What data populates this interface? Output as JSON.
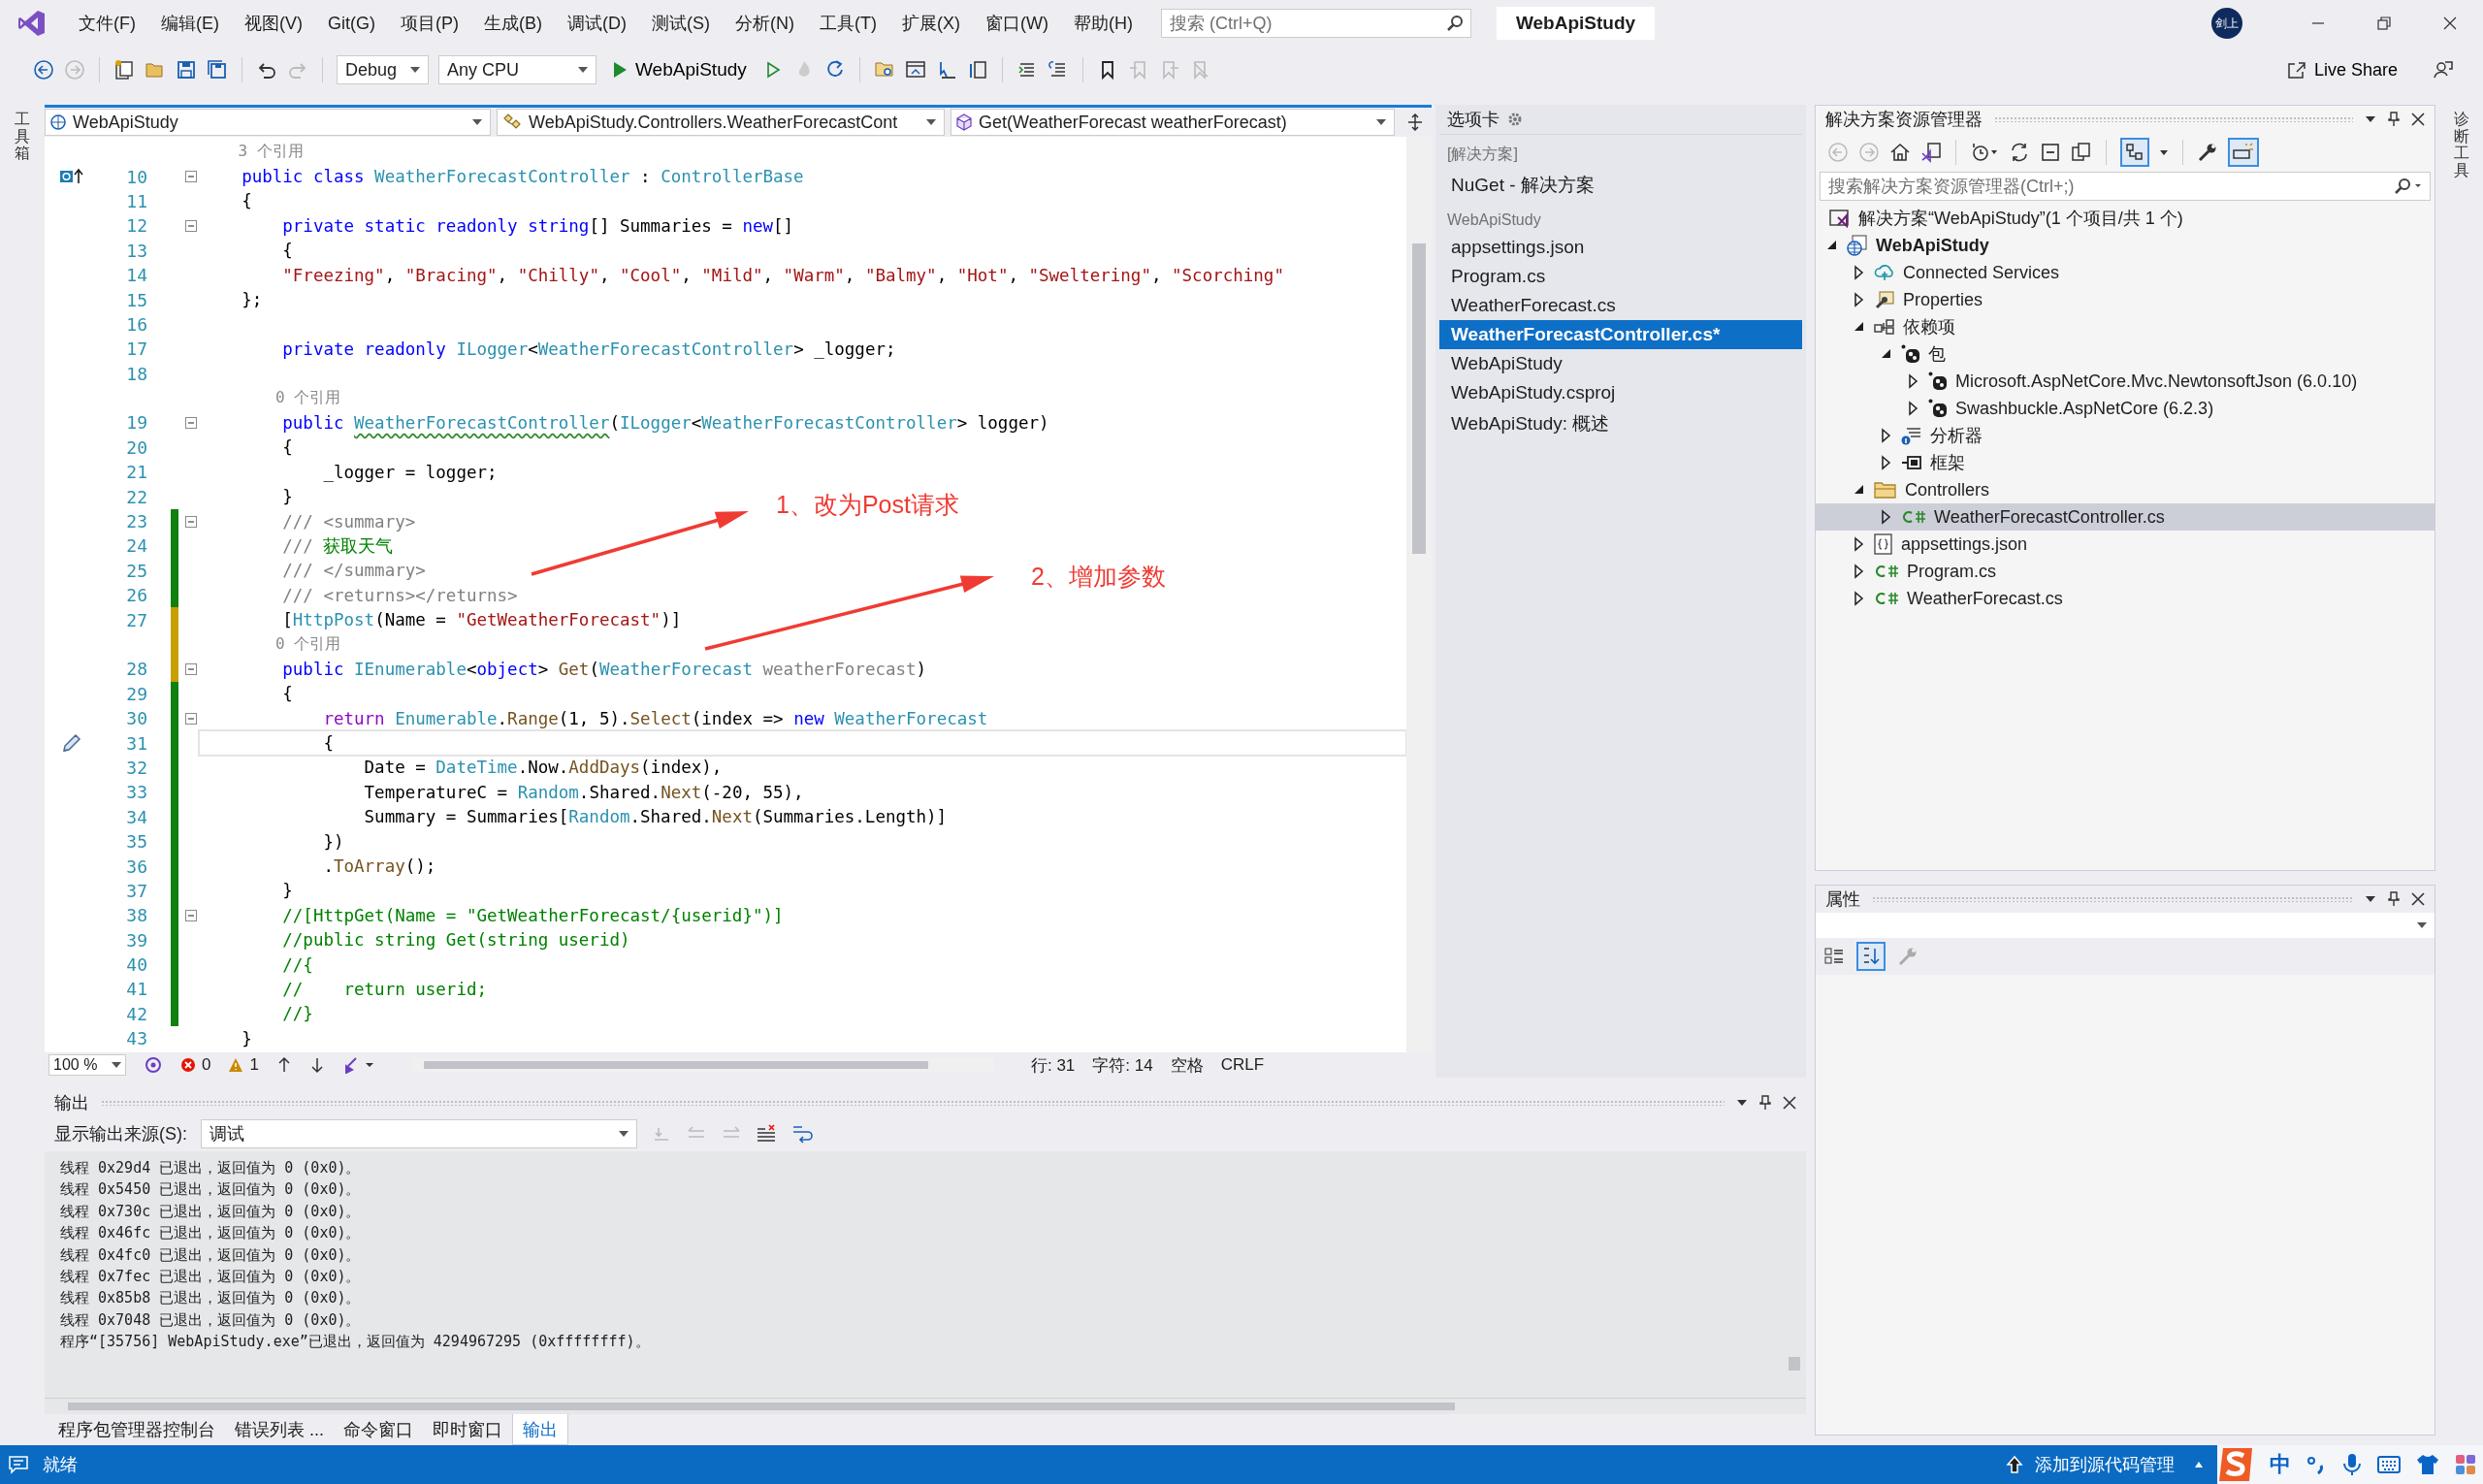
{
  "title_bar": {
    "menu": [
      "文件(F)",
      "编辑(E)",
      "视图(V)",
      "Git(G)",
      "项目(P)",
      "生成(B)",
      "调试(D)",
      "测试(S)",
      "分析(N)",
      "工具(T)",
      "扩展(X)",
      "窗口(W)",
      "帮助(H)"
    ],
    "search": {
      "placeholder": "搜索 (Ctrl+Q)"
    },
    "title": "WebApiStudy",
    "avatar": "剑上"
  },
  "toolbar": {
    "configuration": "Debug",
    "platform": "Any CPU",
    "start": "WebApiStudy",
    "live_share": "Live Share"
  },
  "side_strips": {
    "left": "工具箱",
    "right": "诊断工具"
  },
  "nav_bar": {
    "project": "WebApiStudy",
    "type": "WebApiStudy.Controllers.WeatherForecastCont",
    "member": "Get(WeatherForecast weatherForecast)"
  },
  "code_lines": [
    {
      "kind": "ref",
      "text": "    3 个引用"
    },
    {
      "kind": "code",
      "number": "10",
      "glyph": true,
      "fold": true,
      "tokens": [
        {
          "text": "    public",
          "kind": "keyword"
        },
        {
          "text": " class",
          "kind": "keyword"
        },
        {
          "text": " WeatherForecastController",
          "kind": "type"
        },
        {
          "text": " : ",
          "kind": "plain"
        },
        {
          "text": "ControllerBase",
          "kind": "type"
        }
      ]
    },
    {
      "kind": "code",
      "number": "11",
      "tokens": [
        {
          "text": "    {",
          "kind": "plain"
        }
      ]
    },
    {
      "kind": "code",
      "number": "12",
      "fold": true,
      "tokens": [
        {
          "text": "        private static readonly string",
          "kind": "keyword"
        },
        {
          "text": "[] Summaries = ",
          "kind": "plain"
        },
        {
          "text": "new",
          "kind": "keyword"
        },
        {
          "text": "[]",
          "kind": "plain"
        }
      ]
    },
    {
      "kind": "code",
      "number": "13",
      "tokens": [
        {
          "text": "        {",
          "kind": "plain"
        }
      ]
    },
    {
      "kind": "code",
      "number": "14",
      "tokens": [
        {
          "text": "        \"Freezing\"",
          "kind": "string"
        },
        {
          "text": ", ",
          "kind": "plain"
        },
        {
          "text": "\"Bracing\"",
          "kind": "string"
        },
        {
          "text": ", ",
          "kind": "plain"
        },
        {
          "text": "\"Chilly\"",
          "kind": "string"
        },
        {
          "text": ", ",
          "kind": "plain"
        },
        {
          "text": "\"Cool\"",
          "kind": "string"
        },
        {
          "text": ", ",
          "kind": "plain"
        },
        {
          "text": "\"Mild\"",
          "kind": "string"
        },
        {
          "text": ", ",
          "kind": "plain"
        },
        {
          "text": "\"Warm\"",
          "kind": "string"
        },
        {
          "text": ", ",
          "kind": "plain"
        },
        {
          "text": "\"Balmy\"",
          "kind": "string"
        },
        {
          "text": ", ",
          "kind": "plain"
        },
        {
          "text": "\"Hot\"",
          "kind": "string"
        },
        {
          "text": ", ",
          "kind": "plain"
        },
        {
          "text": "\"Sweltering\"",
          "kind": "string"
        },
        {
          "text": ", ",
          "kind": "plain"
        },
        {
          "text": "\"Scorching\"",
          "kind": "string"
        }
      ]
    },
    {
      "kind": "code",
      "number": "15",
      "tokens": [
        {
          "text": "    };",
          "kind": "plain"
        }
      ]
    },
    {
      "kind": "code",
      "number": "16"
    },
    {
      "kind": "code",
      "number": "17",
      "tokens": [
        {
          "text": "        private readonly",
          "kind": "keyword"
        },
        {
          "text": " ILogger",
          "kind": "type"
        },
        {
          "text": "<",
          "kind": "plain"
        },
        {
          "text": "WeatherForecastController",
          "kind": "type"
        },
        {
          "text": "> _logger;",
          "kind": "plain"
        }
      ]
    },
    {
      "kind": "code",
      "number": "18"
    },
    {
      "kind": "ref",
      "text": "        0 个引用"
    },
    {
      "kind": "code",
      "number": "19",
      "fold": true,
      "tokens": [
        {
          "text": "        public ",
          "kind": "keyword"
        },
        {
          "text": "WeatherForecastController",
          "kind": "squiggle"
        },
        {
          "text": "(",
          "kind": "plain"
        },
        {
          "text": "ILogger",
          "kind": "type"
        },
        {
          "text": "<",
          "kind": "plain"
        },
        {
          "text": "WeatherForecastController",
          "kind": "type"
        },
        {
          "text": "> logger)",
          "kind": "plain"
        }
      ]
    },
    {
      "kind": "code",
      "number": "20",
      "tokens": [
        {
          "text": "        {",
          "kind": "plain"
        }
      ]
    },
    {
      "kind": "code",
      "number": "21",
      "tokens": [
        {
          "text": "            _logger = logger;",
          "kind": "plain"
        }
      ]
    },
    {
      "kind": "code",
      "number": "22",
      "tokens": [
        {
          "text": "        }",
          "kind": "plain"
        }
      ]
    },
    {
      "kind": "code",
      "number": "23",
      "fold": true,
      "changed": true,
      "saved": true,
      "tokens": [
        {
          "text": "        /// <summary>",
          "kind": "doc"
        }
      ]
    },
    {
      "kind": "code",
      "number": "24",
      "changed": true,
      "saved": true,
      "tokens": [
        {
          "text": "        /// ",
          "kind": "doc"
        },
        {
          "text": "获取天气",
          "kind": "comment"
        }
      ]
    },
    {
      "kind": "code",
      "number": "25",
      "changed": true,
      "saved": true,
      "tokens": [
        {
          "text": "        /// </summary>",
          "kind": "doc"
        }
      ]
    },
    {
      "kind": "code",
      "number": "26",
      "changed": true,
      "saved": true,
      "tokens": [
        {
          "text": "        /// <returns></returns>",
          "kind": "doc"
        }
      ]
    },
    {
      "kind": "code",
      "number": "27",
      "changed": true,
      "saved": false,
      "tokens": [
        {
          "text": "        [",
          "kind": "plain"
        },
        {
          "text": "HttpPost",
          "kind": "type"
        },
        {
          "text": "(Name = ",
          "kind": "plain"
        },
        {
          "text": "\"GetWeatherForecast\"",
          "kind": "string"
        },
        {
          "text": ")]",
          "kind": "plain"
        }
      ]
    },
    {
      "kind": "ref",
      "text": "        0 个引用",
      "changed": true,
      "saved": false
    },
    {
      "kind": "code",
      "number": "28",
      "fold": true,
      "changed": true,
      "saved": false,
      "tokens": [
        {
          "text": "        public",
          "kind": "keyword"
        },
        {
          "text": " IEnumerable",
          "kind": "type"
        },
        {
          "text": "<",
          "kind": "plain"
        },
        {
          "text": "object",
          "kind": "keyword"
        },
        {
          "text": "> ",
          "kind": "plain"
        },
        {
          "text": "Get",
          "kind": "method"
        },
        {
          "text": "(",
          "kind": "plain"
        },
        {
          "text": "WeatherForecast",
          "kind": "type"
        },
        {
          "text": " weatherForecast",
          "kind": "unused"
        },
        {
          "text": ")",
          "kind": "plain"
        }
      ]
    },
    {
      "kind": "code",
      "number": "29",
      "changed": true,
      "saved": true,
      "tokens": [
        {
          "text": "        {",
          "kind": "plain"
        }
      ]
    },
    {
      "kind": "code",
      "number": "30",
      "fold": true,
      "changed": true,
      "saved": true,
      "tokens": [
        {
          "text": "            return",
          "kind": "control"
        },
        {
          "text": " Enumerable",
          "kind": "type"
        },
        {
          "text": ".",
          "kind": "plain"
        },
        {
          "text": "Range",
          "kind": "method"
        },
        {
          "text": "(1, 5).",
          "kind": "plain"
        },
        {
          "text": "Select",
          "kind": "method"
        },
        {
          "text": "(index => ",
          "kind": "plain"
        },
        {
          "text": "new",
          "kind": "keyword"
        },
        {
          "text": " WeatherForecast",
          "kind": "type"
        }
      ]
    },
    {
      "kind": "code",
      "number": "31",
      "current": true,
      "changed": true,
      "saved": true,
      "tokens": [
        {
          "text": "            {",
          "kind": "plain"
        }
      ]
    },
    {
      "kind": "code",
      "number": "32",
      "changed": true,
      "saved": true,
      "tokens": [
        {
          "text": "                Date = ",
          "kind": "plain"
        },
        {
          "text": "DateTime",
          "kind": "type"
        },
        {
          "text": ".Now.",
          "kind": "plain"
        },
        {
          "text": "AddDays",
          "kind": "method"
        },
        {
          "text": "(index),",
          "kind": "plain"
        }
      ]
    },
    {
      "kind": "code",
      "number": "33",
      "changed": true,
      "saved": true,
      "tokens": [
        {
          "text": "                TemperatureC = ",
          "kind": "plain"
        },
        {
          "text": "Random",
          "kind": "type"
        },
        {
          "text": ".Shared.",
          "kind": "plain"
        },
        {
          "text": "Next",
          "kind": "method"
        },
        {
          "text": "(-20, 55),",
          "kind": "plain"
        }
      ]
    },
    {
      "kind": "code",
      "number": "34",
      "changed": true,
      "saved": true,
      "tokens": [
        {
          "text": "                Summary = Summaries[",
          "kind": "plain"
        },
        {
          "text": "Random",
          "kind": "type"
        },
        {
          "text": ".Shared.",
          "kind": "plain"
        },
        {
          "text": "Next",
          "kind": "method"
        },
        {
          "text": "(Summaries.Length)]",
          "kind": "plain"
        }
      ]
    },
    {
      "kind": "code",
      "number": "35",
      "changed": true,
      "saved": true,
      "tokens": [
        {
          "text": "            })",
          "kind": "plain"
        }
      ]
    },
    {
      "kind": "code",
      "number": "36",
      "changed": true,
      "saved": true,
      "tokens": [
        {
          "text": "            .",
          "kind": "plain"
        },
        {
          "text": "ToArray",
          "kind": "method"
        },
        {
          "text": "();",
          "kind": "plain"
        }
      ]
    },
    {
      "kind": "code",
      "number": "37",
      "changed": true,
      "saved": true,
      "tokens": [
        {
          "text": "        }",
          "kind": "plain"
        }
      ]
    },
    {
      "kind": "code",
      "number": "38",
      "fold": true,
      "changed": true,
      "saved": true,
      "tokens": [
        {
          "text": "        //[HttpGet(Name = \"GetWeatherForecast/{userid}\")]",
          "kind": "comment"
        }
      ]
    },
    {
      "kind": "code",
      "number": "39",
      "changed": true,
      "saved": true,
      "tokens": [
        {
          "text": "        //public string Get(string userid)",
          "kind": "comment"
        }
      ]
    },
    {
      "kind": "code",
      "number": "40",
      "changed": true,
      "saved": true,
      "tokens": [
        {
          "text": "        //{",
          "kind": "comment"
        }
      ]
    },
    {
      "kind": "code",
      "number": "41",
      "changed": true,
      "saved": true,
      "tokens": [
        {
          "text": "        //    return userid;",
          "kind": "comment"
        }
      ]
    },
    {
      "kind": "code",
      "number": "42",
      "changed": true,
      "saved": true,
      "tokens": [
        {
          "text": "        //}",
          "kind": "comment"
        }
      ]
    },
    {
      "kind": "code",
      "number": "43",
      "tokens": [
        {
          "text": "    }",
          "kind": "plain"
        }
      ]
    }
  ],
  "annotations": [
    {
      "text": "1、改为Post请求"
    },
    {
      "text": "2、增加参数"
    }
  ],
  "editor_status": {
    "zoom": "100 %",
    "errors": "0",
    "warnings": "1",
    "line": "行: 31",
    "char": "字符: 14",
    "indent": "空格",
    "eol": "CRLF"
  },
  "tab_panel": {
    "title": "选项卡",
    "groups": [
      {
        "name": "[解决方案]",
        "items": [
          {
            "label": "NuGet - 解决方案",
            "selected": false
          }
        ]
      },
      {
        "name": "WebApiStudy",
        "items": [
          {
            "label": "appsettings.json",
            "selected": false
          },
          {
            "label": "Program.cs",
            "selected": false
          },
          {
            "label": "WeatherForecast.cs",
            "selected": false
          },
          {
            "label": "WeatherForecastController.cs*",
            "selected": true
          },
          {
            "label": "WebApiStudy",
            "selected": false
          },
          {
            "label": "WebApiStudy.csproj",
            "selected": false
          },
          {
            "label": "WebApiStudy: 概述",
            "selected": false
          }
        ]
      }
    ]
  },
  "solution_explorer": {
    "title": "解决方案资源管理器",
    "search": {
      "placeholder": "搜索解决方案资源管理器(Ctrl+;)"
    },
    "tree": [
      {
        "label": "解决方案“WebApiStudy”(1 个项目/共 1 个)",
        "kind": "solution",
        "selected": false,
        "children": [
          {
            "label": "WebApiStudy",
            "kind": "project",
            "expanded": true,
            "selected": false,
            "children": [
              {
                "label": "Connected Services",
                "kind": "service",
                "expanded": false,
                "selected": false
              },
              {
                "label": "Properties",
                "kind": "properties",
                "expanded": false,
                "selected": false
              },
              {
                "label": "依赖项",
                "kind": "dependencies",
                "expanded": true,
                "selected": false,
                "children": [
                  {
                    "label": "包",
                    "kind": "package",
                    "expanded": true,
                    "selected": false,
                    "children": [
                      {
                        "label": "Microsoft.AspNetCore.Mvc.NewtonsoftJson (6.0.10)",
                        "kind": "package",
                        "expanded": false,
                        "selected": false
                      },
                      {
                        "label": "Swashbuckle.AspNetCore (6.2.3)",
                        "kind": "package",
                        "expanded": false,
                        "selected": false
                      }
                    ]
                  },
                  {
                    "label": "分析器",
                    "kind": "analyzers",
                    "expanded": false,
                    "selected": false
                  },
                  {
                    "label": "框架",
                    "kind": "framework",
                    "expanded": false,
                    "selected": false
                  }
                ]
              },
              {
                "label": "Controllers",
                "kind": "folder",
                "expanded": true,
                "selected": false,
                "children": [
                  {
                    "label": "WeatherForecastController.cs",
                    "kind": "csharp",
                    "expanded": false,
                    "selected": true
                  }
                ]
              },
              {
                "label": "appsettings.json",
                "kind": "json",
                "expanded": false,
                "selected": false
              },
              {
                "label": "Program.cs",
                "kind": "csharp",
                "expanded": false,
                "selected": false
              },
              {
                "label": "WeatherForecast.cs",
                "kind": "csharp",
                "expanded": false,
                "selected": false
              }
            ]
          }
        ]
      }
    ]
  },
  "properties": {
    "title": "属性"
  },
  "output": {
    "title": "输出",
    "source_label": "显示输出来源(S):",
    "source": "调试",
    "lines": [
      "线程 0x29d4 已退出，返回值为 0 (0x0)。",
      "线程 0x5450 已退出，返回值为 0 (0x0)。",
      "线程 0x730c 已退出，返回值为 0 (0x0)。",
      "线程 0x46fc 已退出，返回值为 0 (0x0)。",
      "线程 0x4fc0 已退出，返回值为 0 (0x0)。",
      "线程 0x7fec 已退出，返回值为 0 (0x0)。",
      "线程 0x85b8 已退出，返回值为 0 (0x0)。",
      "线程 0x7048 已退出，返回值为 0 (0x0)。",
      "程序“[35756] WebApiStudy.exe”已退出，返回值为 4294967295 (0xffffffff)。"
    ],
    "tabs": [
      {
        "label": "程序包管理器控制台",
        "selected": false
      },
      {
        "label": "错误列表 ...",
        "selected": false
      },
      {
        "label": "命令窗口",
        "selected": false
      },
      {
        "label": "即时窗口",
        "selected": false
      },
      {
        "label": "输出",
        "selected": true
      }
    ]
  },
  "status_bar": {
    "state": "就绪",
    "source_control": "添加到源代码管理",
    "ime": "中"
  }
}
